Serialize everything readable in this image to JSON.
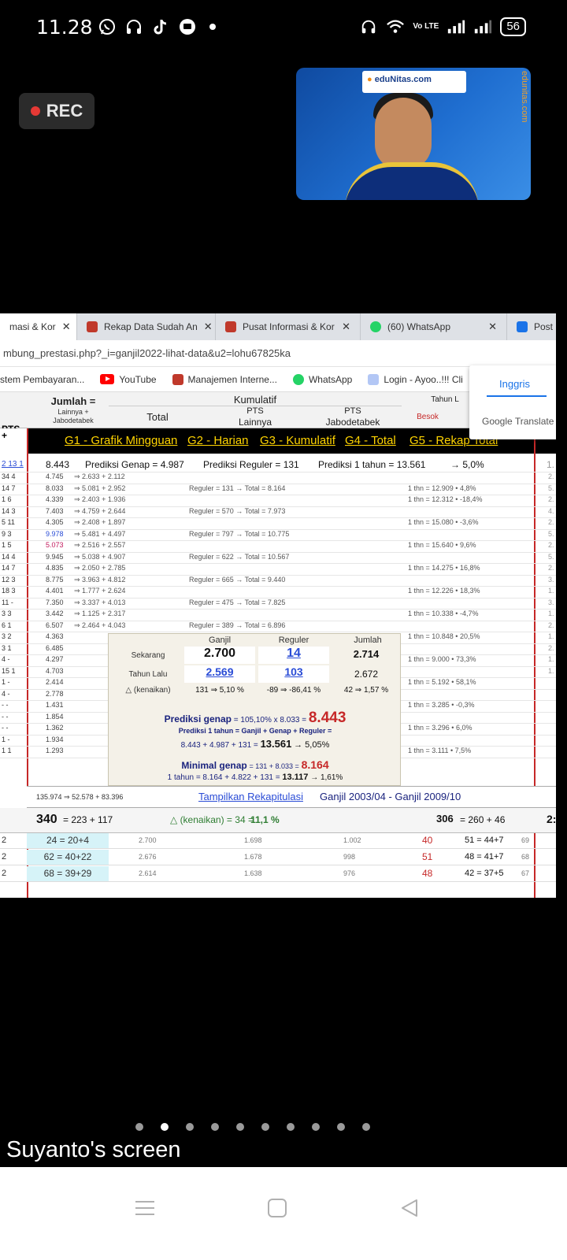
{
  "status_bar": {
    "time": "11.28",
    "left_icons": [
      "whatsapp-icon",
      "headset-icon",
      "tiktok-icon",
      "chat-icon"
    ],
    "right_icons": [
      "headset-icon",
      "wifi-icon",
      "volte-icon",
      "signal-icon",
      "signal-icon"
    ],
    "volte_text": "Vo LTE",
    "battery": "56"
  },
  "recording": {
    "label": "REC",
    "color": "#e53935"
  },
  "video": {
    "logo_text": "eduNitas.com",
    "logo_tagline": "Being Successful is Easy",
    "side_url": "edunitas.com"
  },
  "browser": {
    "tabs": [
      {
        "label": "masi & Kor",
        "active": true
      },
      {
        "label": "Rekap Data Sudah An"
      },
      {
        "label": "Pusat Informasi & Kor"
      },
      {
        "label": "(60) WhatsApp"
      },
      {
        "label": "Post"
      }
    ],
    "url": "mbung_prestasi.php?_i=ganjil2022-lihat-data&u2=lohu67825ka",
    "bookmarks": [
      "stem Pembayaran...",
      "YouTube",
      "Manajemen Interne...",
      "WhatsApp",
      "Login - Ayoo..!!! Cli"
    ],
    "translate_popup": {
      "language": "Inggris",
      "brand": "Google Translate"
    }
  },
  "sheet": {
    "header": {
      "jumlah": "Jumlah =",
      "jumlah_sub1": "Lainnya +",
      "jumlah_sub2": "Jabodetabek",
      "kumulatif": "Kumulatif",
      "total": "Total",
      "pts_lainnya_1": "PTS",
      "pts_lainnya_2": "Lainnya",
      "pts_jabo_1": "PTS",
      "pts_jabo_2": "Jabodetabek",
      "tahun": "Tahun L",
      "besok": "Besok",
      "pts_left": "PTS",
      "plus": "+"
    },
    "g_links": [
      "G1 - Grafik Mingguan",
      "G2 - Harian",
      "G3 - Kumulatif",
      "G4 - Total",
      "G5 - Rekap Total"
    ],
    "pred_row": {
      "left": "2 13 1",
      "value": "8.443",
      "genap": "Prediksi Genap = 4.987",
      "reguler": "Prediksi Reguler = 131",
      "tahun": "Prediksi 1 tahun = 13.561",
      "pct": "→ 5,0%",
      "far": "1."
    },
    "rows": [
      {
        "lc": "34 4",
        "v": "4.745",
        "m": "⇒  2.633  +  2.112",
        "r": "",
        "t": ""
      },
      {
        "lc": "14 7",
        "v": "8.033",
        "m": "⇒  5.081  +  2.952",
        "r": "Reguler = 131 → Total = 8.164",
        "t": "1 thn = 12.909  • 4,8%"
      },
      {
        "lc": "1 6",
        "v": "4.339",
        "m": "⇒  2.403  +  1.936",
        "r": "",
        "t": "1 thn = 12.312  • -18,4%"
      },
      {
        "lc": "14 3",
        "v": "7.403",
        "m": "⇒  4.759  +  2.644",
        "r": "Reguler = 570 → Total = 7.973",
        "t": ""
      },
      {
        "lc": "5 11",
        "v": "4.305",
        "m": "⇒  2.408  +  1.897",
        "r": "",
        "t": "1 thn = 15.080  • -3,6%"
      },
      {
        "lc": "9 3",
        "v": "9.978",
        "m": "⇒  5.481  +  4.497",
        "r": "Reguler = 797 → Total = 10.775",
        "t": ""
      },
      {
        "lc": "1 5",
        "v": "5.073",
        "m": "⇒  2.516  +  2.557",
        "r": "",
        "t": "1 thn = 15.640  • 9,6%"
      },
      {
        "lc": "14 4",
        "v": "9.945",
        "m": "⇒  5.038  +  4.907",
        "r": "Reguler = 622 → Total = 10.567",
        "t": ""
      },
      {
        "lc": "14 7",
        "v": "4.835",
        "m": "⇒  2.050  +  2.785",
        "r": "",
        "t": "1 thn = 14.275  • 16,8%"
      },
      {
        "lc": "12 3",
        "v": "8.775",
        "m": "⇒  3.963  +  4.812",
        "r": "Reguler = 665 → Total = 9.440",
        "t": ""
      },
      {
        "lc": "18 3",
        "v": "4.401",
        "m": "⇒  1.777  +  2.624",
        "r": "",
        "t": "1 thn = 12.226  • 18,3%"
      },
      {
        "lc": "11 -",
        "v": "7.350",
        "m": "⇒  3.337  +  4.013",
        "r": "Reguler = 475 → Total = 7.825",
        "t": ""
      },
      {
        "lc": "3 3",
        "v": "3.442",
        "m": "⇒  1.125  +  2.317",
        "r": "",
        "t": "1 thn = 10.338  • -4,7%"
      },
      {
        "lc": "6 1",
        "v": "6.507",
        "m": "⇒  2.464  +  4.043",
        "r": "Reguler = 389 → Total = 6.896",
        "t": ""
      },
      {
        "lc": "3 2",
        "v": "4.363",
        "m": "",
        "r": "",
        "t": "1 thn = 10.848  • 20,5%"
      },
      {
        "lc": "3 1",
        "v": "6.485",
        "m": "",
        "r": "",
        "t": ""
      },
      {
        "lc": "4 -",
        "v": "4.297",
        "m": "",
        "r": "",
        "t": "1 thn = 9.000  • 73,3%"
      },
      {
        "lc": "15 1",
        "v": "4.703",
        "m": "",
        "r": "",
        "t": ""
      },
      {
        "lc": "1 -",
        "v": "2.414",
        "m": "",
        "r": "",
        "t": "1 thn = 5.192  • 58,1%"
      },
      {
        "lc": "4 -",
        "v": "2.778",
        "m": "",
        "r": "",
        "t": ""
      },
      {
        "lc": "- -",
        "v": "1.431",
        "m": "",
        "r": "",
        "t": "1 thn = 3.285  • -0,3%"
      },
      {
        "lc": "- -",
        "v": "1.854",
        "m": "",
        "r": "",
        "t": ""
      },
      {
        "lc": "- -",
        "v": "1.362",
        "m": "",
        "r": "",
        "t": "1 thn = 3.296  • 6,0%"
      },
      {
        "lc": "1 -",
        "v": "1.934",
        "m": "",
        "r": "",
        "t": ""
      },
      {
        "lc": "1 1",
        "v": "1.293",
        "m": "",
        "r": "",
        "t": "1 thn = 3.111  • 7,5%"
      }
    ],
    "far_right": [
      "2.",
      "5.",
      "2.",
      "4.",
      "2.",
      "5.",
      "2.",
      "5.",
      "2.",
      "3.",
      "1.",
      "3.",
      "1.",
      "2.",
      "1.",
      "2.",
      "1.",
      "1."
    ],
    "summary_box": {
      "ganjil": "Ganjil",
      "reguler": "Reguler",
      "jumlah": "Jumlah",
      "sekarang": "Sekarang",
      "sekarang_ganjil": "2.700",
      "sekarang_reguler": "14",
      "sekarang_jumlah": "2.714",
      "tahun_lalu": "Tahun Lalu",
      "tl_ganjil": "2.569",
      "tl_reguler": "103",
      "tl_jumlah": "2.672",
      "kenaikan": "△ (kenaikan)",
      "k_ganjil": "131 ⇒ 5,10 %",
      "k_reguler": "-89 ⇒ -86,41 %",
      "k_jumlah": "42 ⇒ 1,57 %",
      "pred_genap_label": "Prediksi genap",
      "pred_genap_formula": "= 105,10% x 8.033 =",
      "pred_genap_value": "8.443",
      "pred_1thn": "Prediksi 1 tahun = Ganjil + Genap + Reguler =",
      "pred_1thn_calc": "8.443 + 4.987 + 131 =",
      "pred_1thn_value": "13.561",
      "pred_1thn_pct": "→ 5,05%",
      "min_genap_label": "Minimal genap",
      "min_genap_formula": "= 131 + 8.033 =",
      "min_genap_value": "8.164",
      "min_1thn": "1 tahun = 8.164 + 4.822 + 131 =",
      "min_1thn_value": "13.117",
      "min_1thn_pct": "→ 1,61%"
    },
    "summary_row": {
      "values": "135.974  ⇒  52.578  +  83.396",
      "link": "Tampilkan Rekapitulasi",
      "period": "Ganjil 2003/04 - Ganjil 2009/10"
    },
    "totals_row": {
      "left": "340",
      "left_formula": "= 223 + 117",
      "kenaikan": "△ (kenaikan) = 34 =",
      "kenaikan_pct": "11,1 %",
      "right": "306",
      "right_formula": "= 260 + 46",
      "far": "2:"
    },
    "table_rows": [
      {
        "c0": "2",
        "c1": "24 = 20+4",
        "c2": "2.700",
        "c3": "1.698",
        "c4": "1.002",
        "c5": "40",
        "c6": "51 = 44+7",
        "c7": "69"
      },
      {
        "c0": "2",
        "c1": "62 = 40+22",
        "c2": "2.676",
        "c3": "1.678",
        "c4": "998",
        "c5": "51",
        "c6": "48 = 41+7",
        "c7": "68"
      },
      {
        "c0": "2",
        "c1": "68 = 39+29",
        "c2": "2.614",
        "c3": "1.638",
        "c4": "976",
        "c5": "48",
        "c6": "42 = 37+5",
        "c7": "67"
      }
    ]
  },
  "page_dots": {
    "count": 10,
    "active": 1
  },
  "screen_label": "Suyanto's screen",
  "nav": [
    "menu-icon",
    "home-icon",
    "back-icon"
  ]
}
